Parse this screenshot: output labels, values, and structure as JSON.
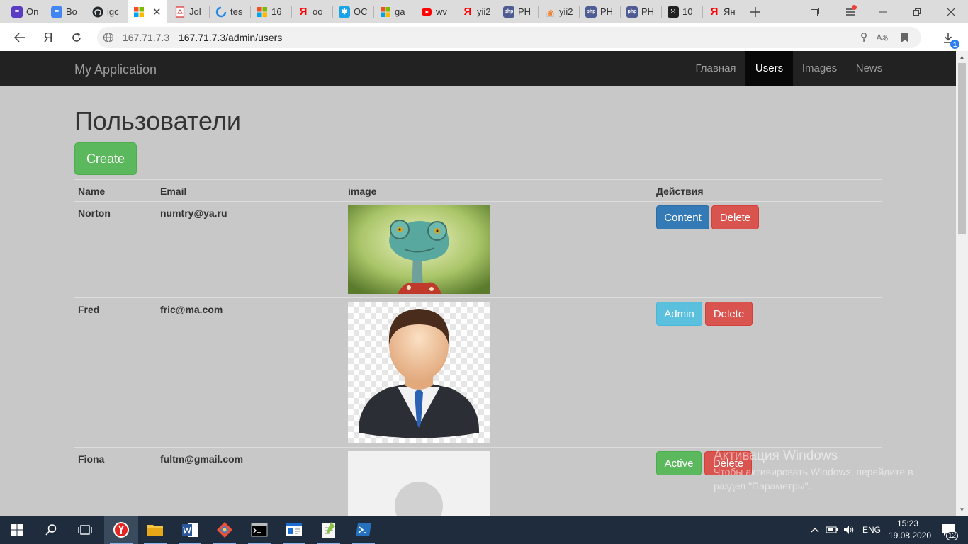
{
  "browser": {
    "tabs": [
      {
        "label": "On",
        "icon": "purple-doc-icon",
        "color": "#5b3cc4"
      },
      {
        "label": "Bo",
        "icon": "google-docs-icon",
        "color": "#4285f4"
      },
      {
        "label": "igc",
        "icon": "github-icon",
        "color": "#24292e"
      },
      {
        "label": "",
        "icon": "microsoft-logo-icon",
        "color": "#f25022"
      },
      {
        "label": "Jol",
        "icon": "pdf-icon",
        "color": "#d93025"
      },
      {
        "label": "tes",
        "icon": "cloud-swirl-icon",
        "color": "#1e88e5"
      },
      {
        "label": "16",
        "icon": "microsoft-logo-icon",
        "color": "#f25022"
      },
      {
        "label": "oo",
        "icon": "yandex-icon",
        "color": "#ff0000"
      },
      {
        "label": "OC",
        "icon": "gear-app-icon",
        "color": "#1aa3e8"
      },
      {
        "label": "ga",
        "icon": "microsoft-logo-icon",
        "color": "#f25022"
      },
      {
        "label": "wv",
        "icon": "youtube-icon",
        "color": "#ff0000"
      },
      {
        "label": "yii2",
        "icon": "yandex-icon",
        "color": "#ff0000"
      },
      {
        "label": "PH",
        "icon": "php-icon",
        "color": "#4f5b93"
      },
      {
        "label": "yii2",
        "icon": "stackoverflow-icon",
        "color": "#f48024"
      },
      {
        "label": "PH",
        "icon": "php-icon",
        "color": "#4f5b93"
      },
      {
        "label": "PH",
        "icon": "php-icon",
        "color": "#4f5b93"
      },
      {
        "label": "10",
        "icon": "dice-icon",
        "color": "#222222"
      },
      {
        "label": "Ян",
        "icon": "yandex-icon",
        "color": "#ff0000"
      }
    ],
    "url_host": "167.71.7.3",
    "url_path": "167.71.7.3/admin/users",
    "download_count": "1"
  },
  "navbar": {
    "brand": "My Application",
    "links": [
      {
        "label": "Главная",
        "active": false
      },
      {
        "label": "Users",
        "active": true
      },
      {
        "label": "Images",
        "active": false
      },
      {
        "label": "News",
        "active": false
      }
    ]
  },
  "page": {
    "title": "Пользователи",
    "create_label": "Create"
  },
  "table": {
    "headers": {
      "name": "Name",
      "email": "Email",
      "image": "image",
      "actions": "Действия"
    },
    "rows": [
      {
        "name": "Norton",
        "email": "numtry@ya.ru",
        "image_icon": "chameleon-photo-icon",
        "primary_label": "Content",
        "primary_style": "primary",
        "delete_label": "Delete"
      },
      {
        "name": "Fred",
        "email": "fric@ma.com",
        "image_icon": "businessman-avatar-icon",
        "primary_label": "Admin",
        "primary_style": "info",
        "delete_label": "Delete"
      },
      {
        "name": "Fiona",
        "email": "fultm@gmail.com",
        "image_icon": "default-avatar-icon",
        "primary_label": "Active",
        "primary_style": "success",
        "delete_label": "Delete"
      }
    ]
  },
  "watermark": {
    "title": "Активация Windows",
    "line1": "Чтобы активировать Windows, перейдите в",
    "line2": "раздел \"Параметры\"."
  },
  "taskbar": {
    "language": "ENG",
    "time": "15:23",
    "date": "19.08.2020",
    "notification_count": "12"
  },
  "colors": {
    "navbar_bg": "#222222",
    "success": "#5cb85c",
    "primary": "#337ab7",
    "danger": "#d9534f",
    "info": "#5bc0de"
  }
}
